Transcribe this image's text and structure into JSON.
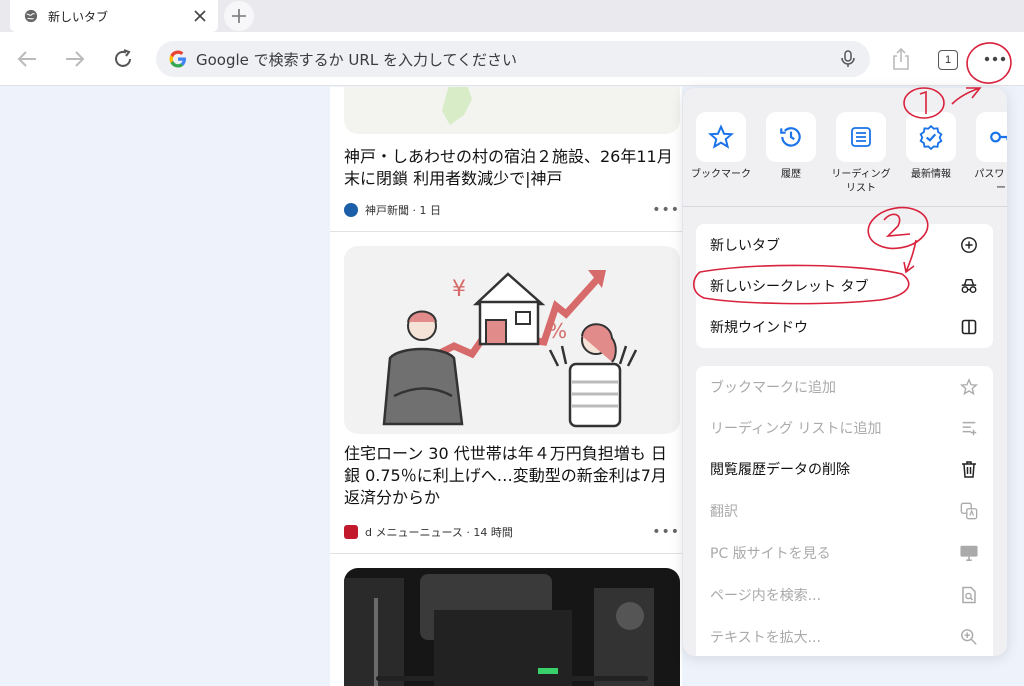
{
  "tab": {
    "title": "新しいタブ"
  },
  "toolbar": {
    "omnibox_placeholder": "Google で検索するか URL を入力してください",
    "tab_count": "1"
  },
  "feed": {
    "articles": [
      {
        "headline": "神戸・しあわせの村の宿泊２施設、26年11月末に閉鎖 利用者数減少で|神戸",
        "source": "神戸新聞 · 1 日"
      },
      {
        "headline": "住宅ローン 30 代世帯は年４万円負担増も 日銀 0.75％に利上げへ…変動型の新金利は7月返済分からか",
        "source": "d メニューニュース · 14 時間"
      }
    ],
    "illustration": {
      "yen": "¥",
      "percent": "%"
    }
  },
  "menu": {
    "shortcuts": [
      {
        "label": "ブックマーク",
        "icon": "star-icon"
      },
      {
        "label": "履歴",
        "icon": "history-icon"
      },
      {
        "label": "リーディング リスト",
        "icon": "reading-list-icon"
      },
      {
        "label": "最新情報",
        "icon": "badge-check-icon"
      },
      {
        "label": "パスワ マネー",
        "icon": "key-icon"
      }
    ],
    "group1": [
      {
        "label": "新しいタブ",
        "icon": "plus-circle-icon"
      },
      {
        "label": "新しいシークレット タブ",
        "icon": "incognito-icon"
      },
      {
        "label": "新規ウインドウ",
        "icon": "window-icon"
      }
    ],
    "group2": [
      {
        "label": "ブックマークに追加",
        "icon": "star-outline-icon",
        "enabled": false
      },
      {
        "label": "リーディング リストに追加",
        "icon": "reading-list-add-icon",
        "enabled": false
      },
      {
        "label": "閲覧履歴データの削除",
        "icon": "trash-icon",
        "enabled": true
      },
      {
        "label": "翻訳",
        "icon": "translate-icon",
        "enabled": false
      },
      {
        "label": "PC 版サイトを見る",
        "icon": "desktop-icon",
        "enabled": false
      },
      {
        "label": "ページ内を検索...",
        "icon": "find-in-page-icon",
        "enabled": false
      },
      {
        "label": "テキストを拡大...",
        "icon": "zoom-in-icon",
        "enabled": false
      }
    ]
  },
  "colors": {
    "accent": "#1a73e8",
    "annotation": "#d9223c",
    "menu_bg": "#f0f0f3"
  }
}
